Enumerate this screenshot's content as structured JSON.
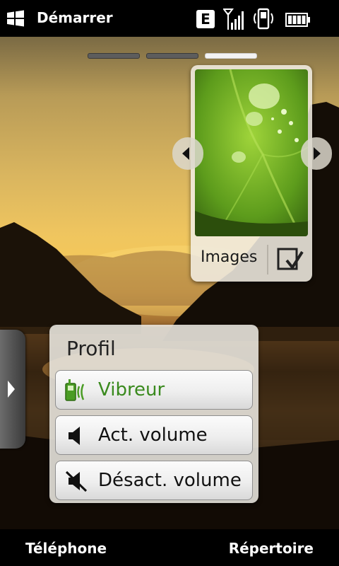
{
  "status_bar": {
    "title": "Démarrer",
    "network_type": "E",
    "icons": [
      "windows-logo-icon",
      "edge-network-icon",
      "signal-strength-icon",
      "vibrate-mode-icon",
      "battery-icon"
    ]
  },
  "pager": {
    "pages": 3,
    "active_page": 3
  },
  "images_widget": {
    "label": "Images"
  },
  "profile_widget": {
    "title": "Profil",
    "options": [
      {
        "label": "Vibreur",
        "icon": "vibrate-icon",
        "active": true
      },
      {
        "label": "Act. volume",
        "icon": "speaker-icon",
        "active": false
      },
      {
        "label": "Désact. volume",
        "icon": "speaker-muted-icon",
        "active": false
      }
    ]
  },
  "soft_keys": {
    "left": "Téléphone",
    "right": "Répertoire"
  },
  "colors": {
    "active_option": "#3a8a1e",
    "bar_background": "#000000"
  }
}
